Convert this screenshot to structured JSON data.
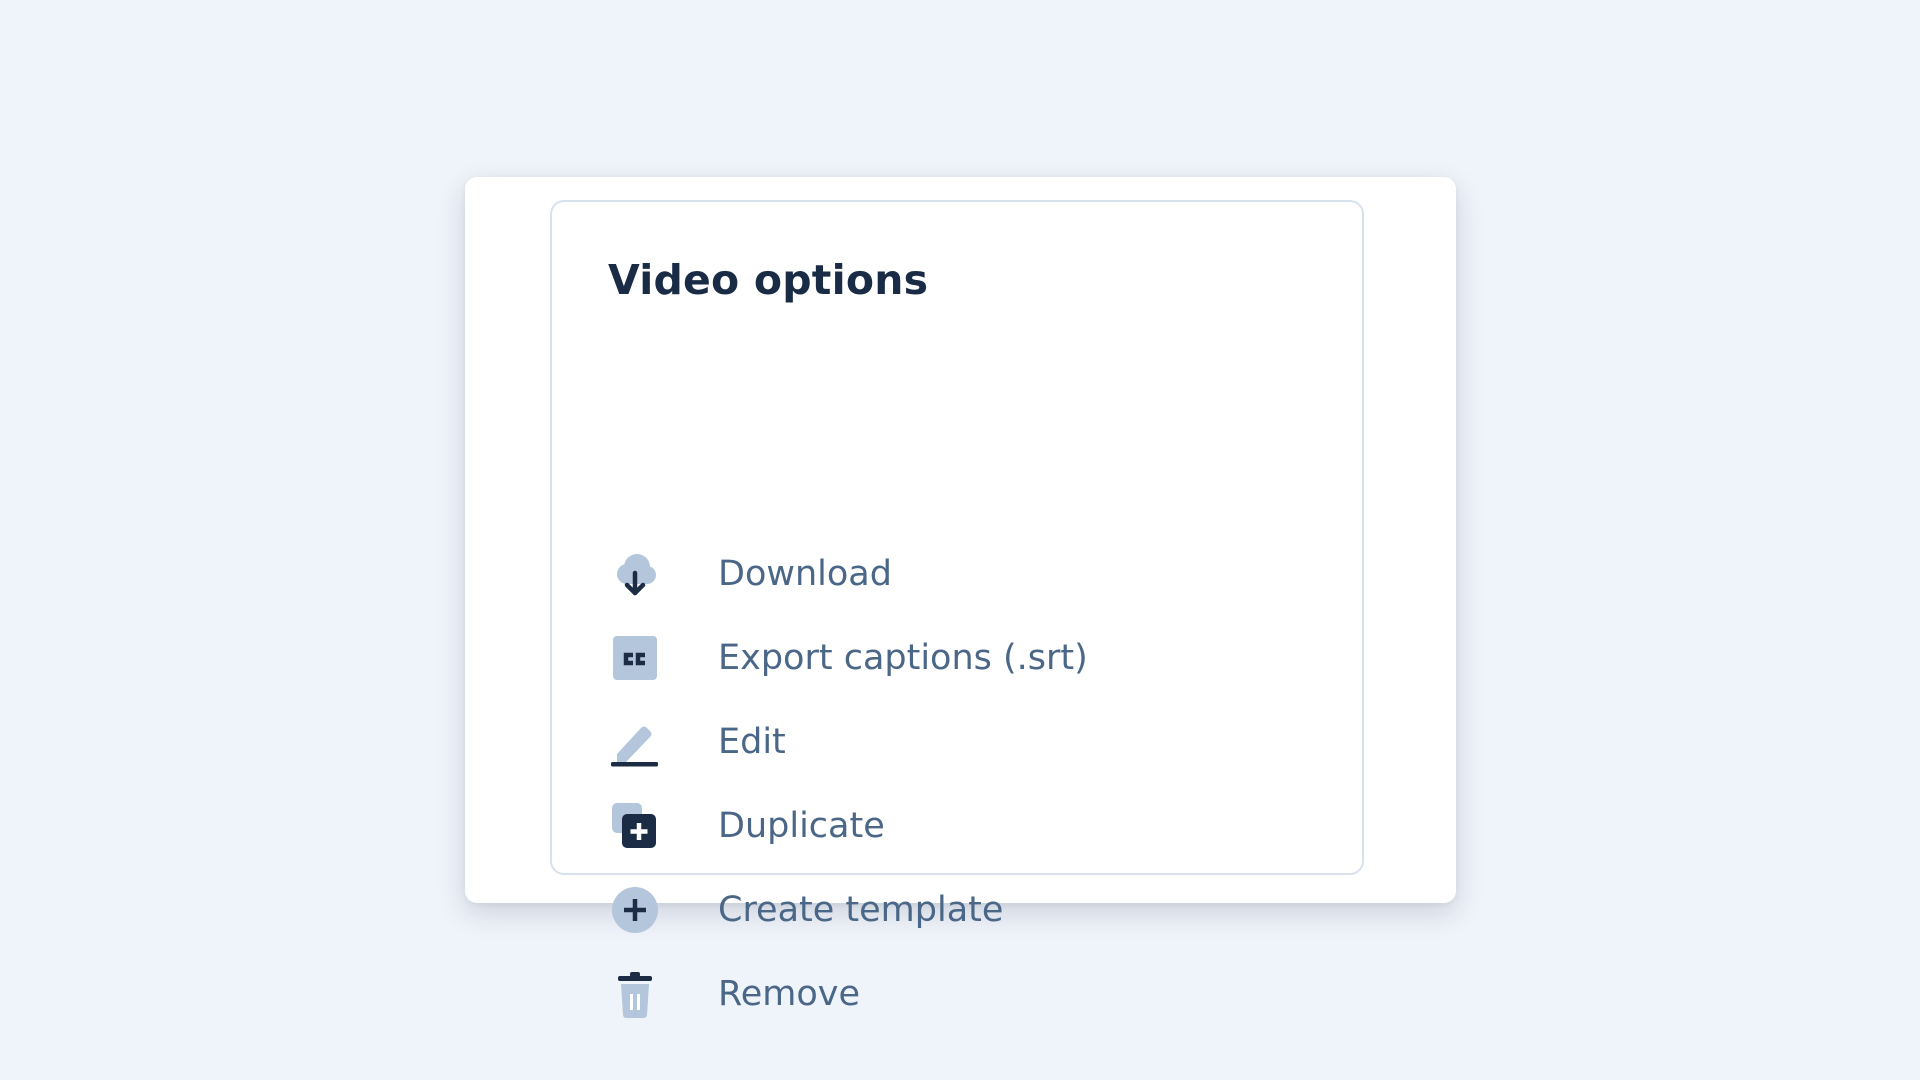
{
  "menu": {
    "title": "Video options",
    "items": [
      {
        "label": "Download",
        "icon": "cloud-download-icon"
      },
      {
        "label": "Export captions (.srt)",
        "icon": "closed-captions-icon"
      },
      {
        "label": "Edit",
        "icon": "pencil-icon"
      },
      {
        "label": "Duplicate",
        "icon": "duplicate-icon"
      },
      {
        "label": "Create template",
        "icon": "plus-circle-icon"
      },
      {
        "label": "Remove",
        "icon": "trash-icon"
      }
    ]
  },
  "colors": {
    "background": "#eff3fa",
    "title": "#1a2b45",
    "label": "#4a6787",
    "icon_light": "#b3c6dc",
    "icon_dark": "#1c2c44",
    "border": "#d8e2ee"
  }
}
